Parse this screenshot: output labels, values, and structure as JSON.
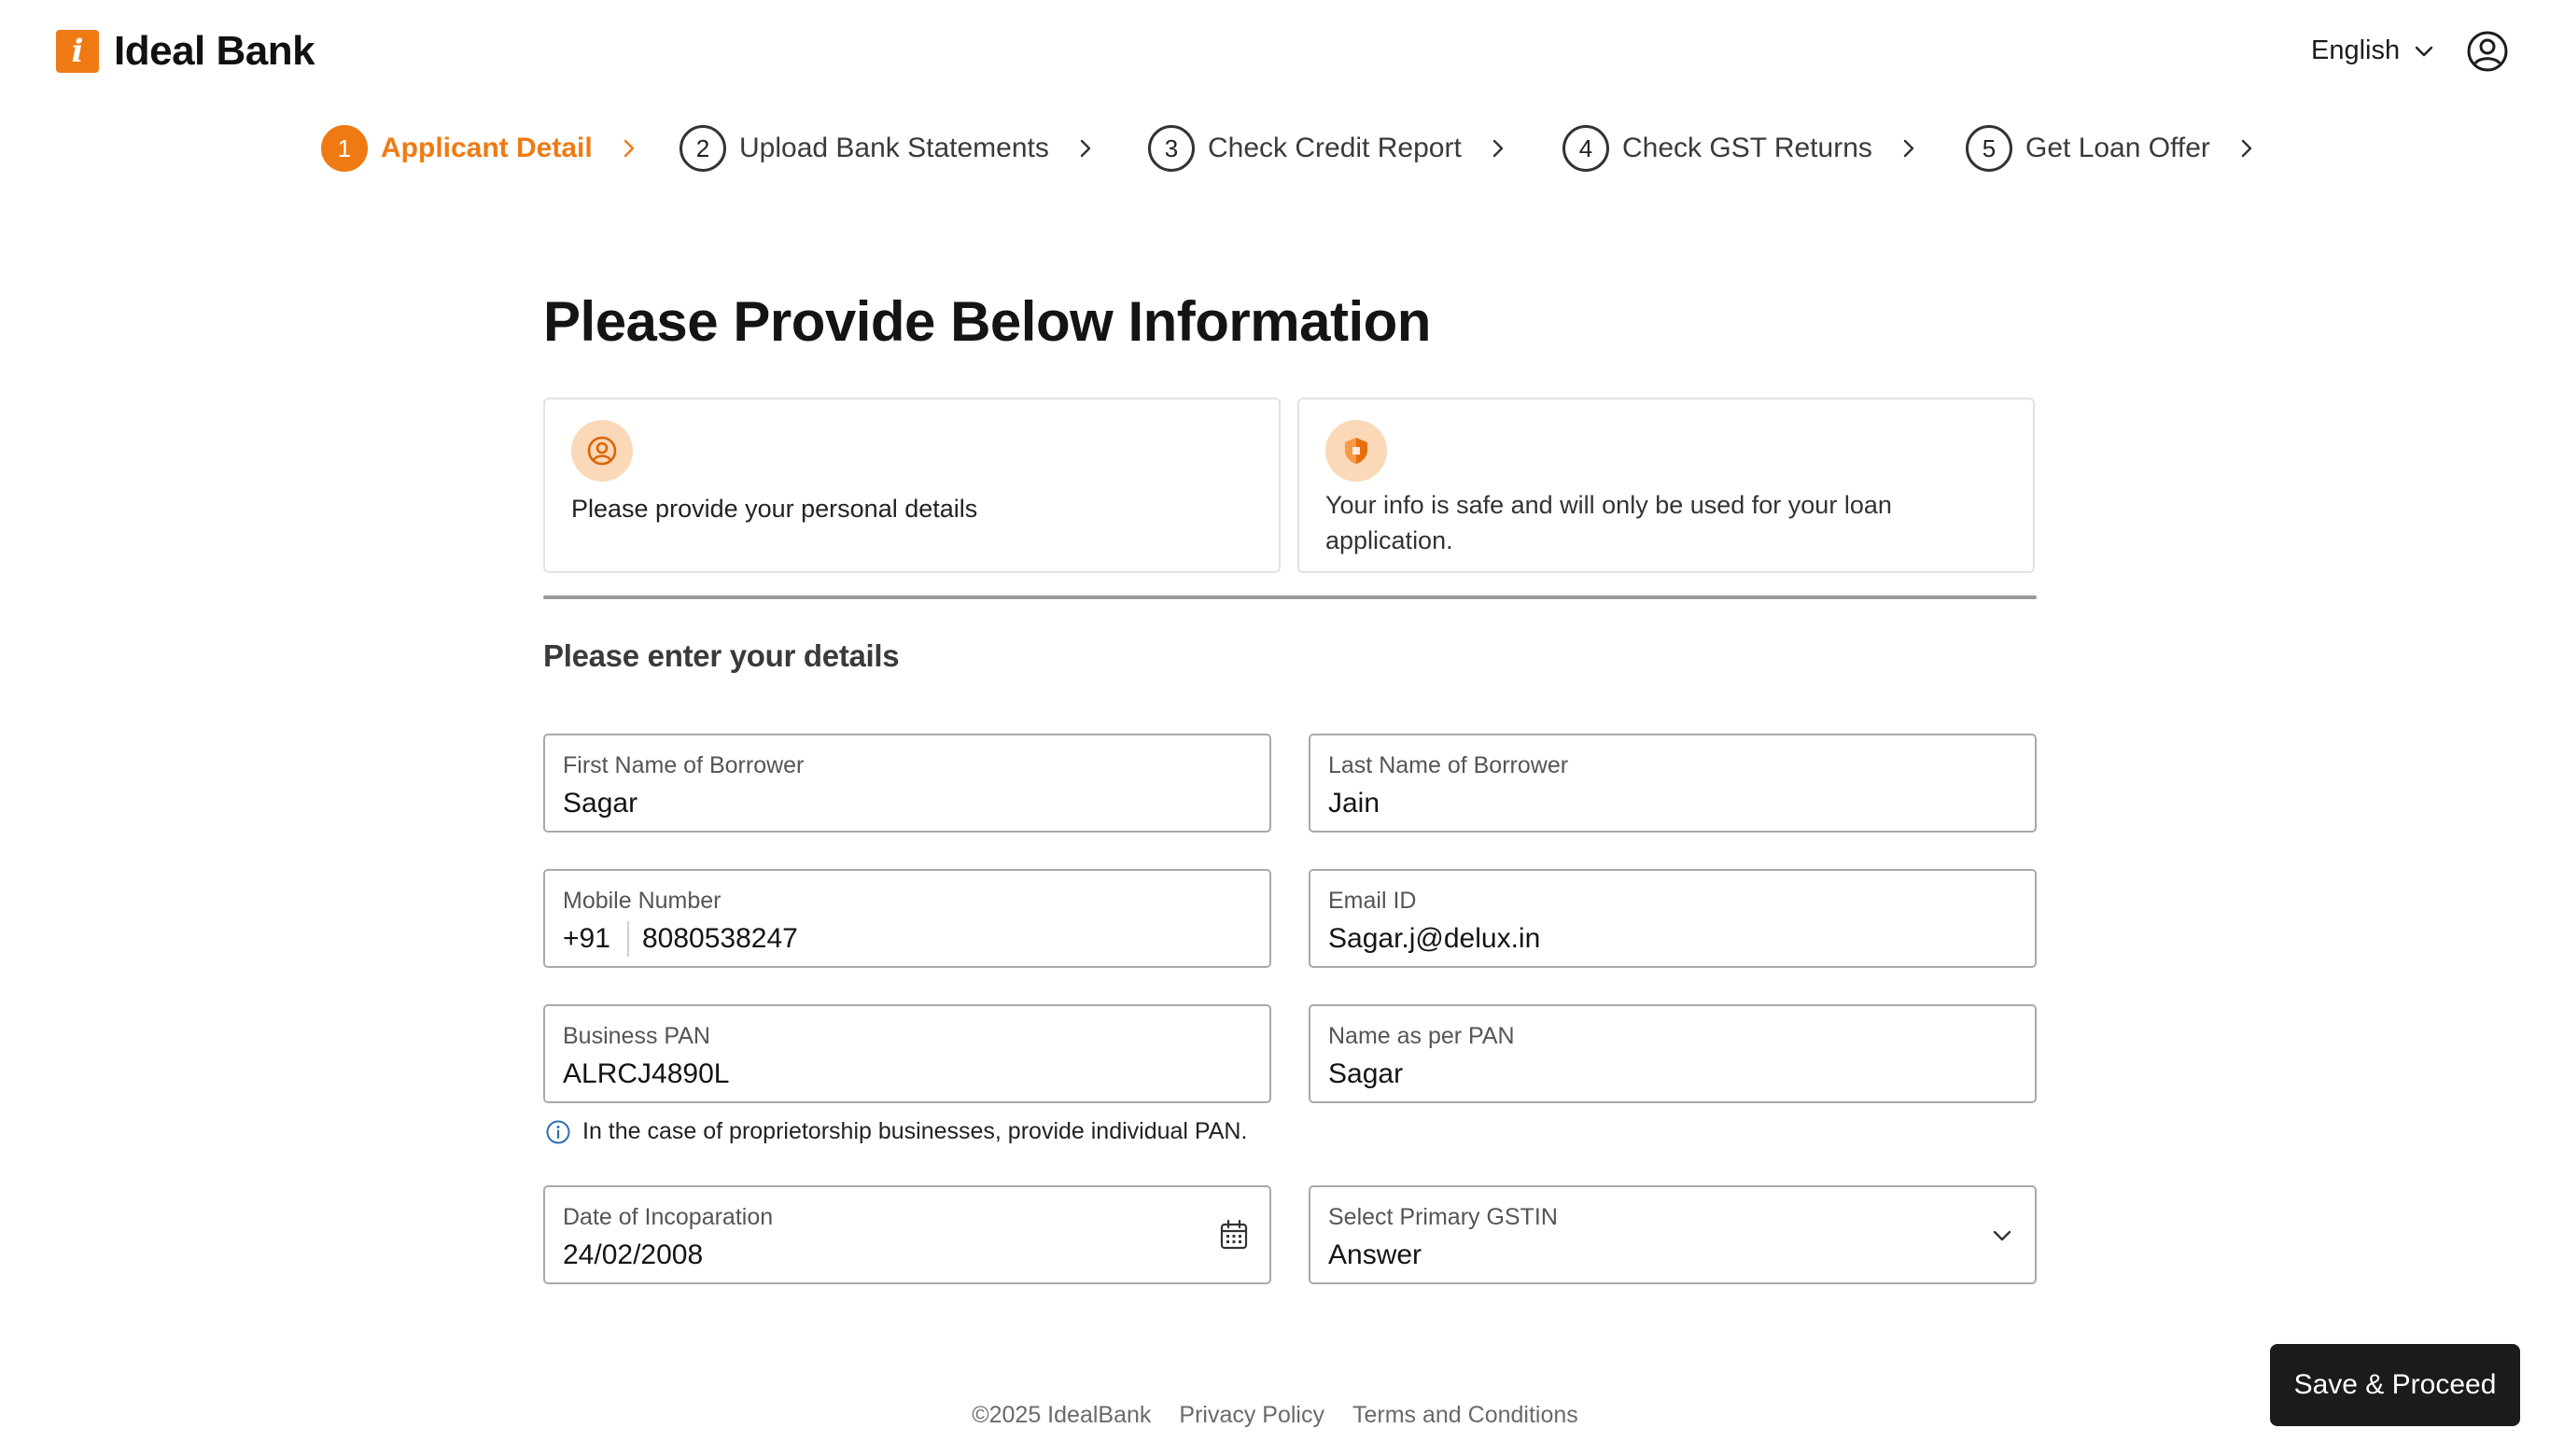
{
  "header": {
    "brand_mark": "i",
    "brand_name": "Ideal Bank",
    "language": "English"
  },
  "stepper": [
    {
      "number": "1",
      "label": "Applicant Detail",
      "active": true
    },
    {
      "number": "2",
      "label": "Upload Bank Statements",
      "active": false
    },
    {
      "number": "3",
      "label": "Check Credit Report",
      "active": false
    },
    {
      "number": "4",
      "label": "Check GST Returns",
      "active": false
    },
    {
      "number": "5",
      "label": "Get Loan Offer",
      "active": false
    }
  ],
  "page_title": "Please Provide Below Information",
  "info_cards": [
    {
      "icon": "user-circle-icon",
      "text": "Please provide your personal details"
    },
    {
      "icon": "shield-icon",
      "text_line1": "Your info is safe and will only be used for your loan",
      "text_line2": "application."
    }
  ],
  "form": {
    "heading": "Please enter your details",
    "first_name": {
      "label": "First Name of Borrower",
      "value": "Sagar"
    },
    "last_name": {
      "label": "Last Name of Borrower",
      "value": "Jain"
    },
    "mobile": {
      "label": "Mobile Number",
      "prefix": "+91",
      "value": "8080538247"
    },
    "email": {
      "label": "Email ID",
      "value": "Sagar.j@delux.in"
    },
    "business_pan": {
      "label": "Business PAN",
      "value": "ALRCJ4890L"
    },
    "name_per_pan": {
      "label": "Name as per PAN",
      "value": "Sagar"
    },
    "pan_hint": "In the case of proprietorship businesses, provide individual PAN.",
    "date_of_incorporation": {
      "label": "Date of Incoparation",
      "value": "24/02/2008"
    },
    "primary_gstin": {
      "label": "Select Primary GSTIN",
      "value": "Answer"
    }
  },
  "actions": {
    "save_label": "Save & Proceed"
  },
  "footer": {
    "copyright": "©2025 IdealBank",
    "privacy": "Privacy Policy",
    "terms": "Terms and Conditions"
  },
  "colors": {
    "accent": "#ef7a13",
    "accent_light": "#fbd8b7",
    "dark_button": "#1b1b1b",
    "info_blue": "#2f6fb5"
  }
}
